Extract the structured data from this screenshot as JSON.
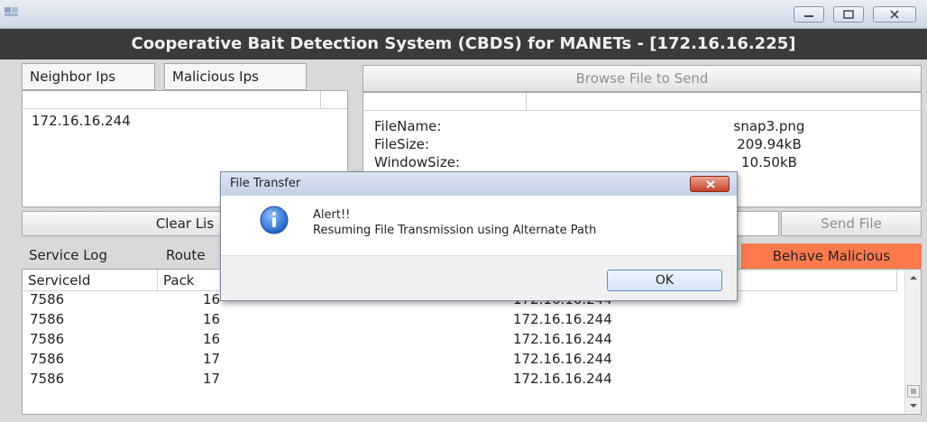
{
  "window": {
    "title": "Cooperative Bait Detection System (CBDS) for MANETs - [172.16.16.225]"
  },
  "left_panel": {
    "tabs": [
      "Neighbor Ips",
      "Malicious Ips"
    ],
    "neighbor_ips": [
      "172.16.16.244"
    ],
    "clear_button": "Clear Lis"
  },
  "right_panel": {
    "browse_button": "Browse File to Send",
    "file_info": [
      {
        "label": "FileName:",
        "value": "snap3.png"
      },
      {
        "label": "FileSize:",
        "value": "209.94kB"
      },
      {
        "label": "WindowSize:",
        "value": "10.50kB"
      }
    ],
    "send_button": "Send File"
  },
  "lower_tabs": [
    "Service Log",
    "Route"
  ],
  "behave_button": "Behave Malicious",
  "service_table": {
    "columns": [
      "ServiceId",
      "Pack"
    ],
    "rows": [
      {
        "service_id": "7586",
        "packet": "16",
        "ip": "172.16.16.244"
      },
      {
        "service_id": "7586",
        "packet": "16",
        "ip": "172.16.16.244"
      },
      {
        "service_id": "7586",
        "packet": "16",
        "ip": "172.16.16.244"
      },
      {
        "service_id": "7586",
        "packet": "17",
        "ip": "172.16.16.244"
      },
      {
        "service_id": "7586",
        "packet": "17",
        "ip": "172.16.16.244"
      }
    ]
  },
  "dialog": {
    "title": "File Transfer",
    "line1": "Alert!!",
    "line2": "Resuming File Transmission using Alternate Path",
    "ok_button": "OK",
    "icon": "info-icon"
  },
  "colors": {
    "header_bg": "#3b3b3b",
    "behave_bg": "#ff7a4d",
    "dialog_close": "#c7432a"
  }
}
